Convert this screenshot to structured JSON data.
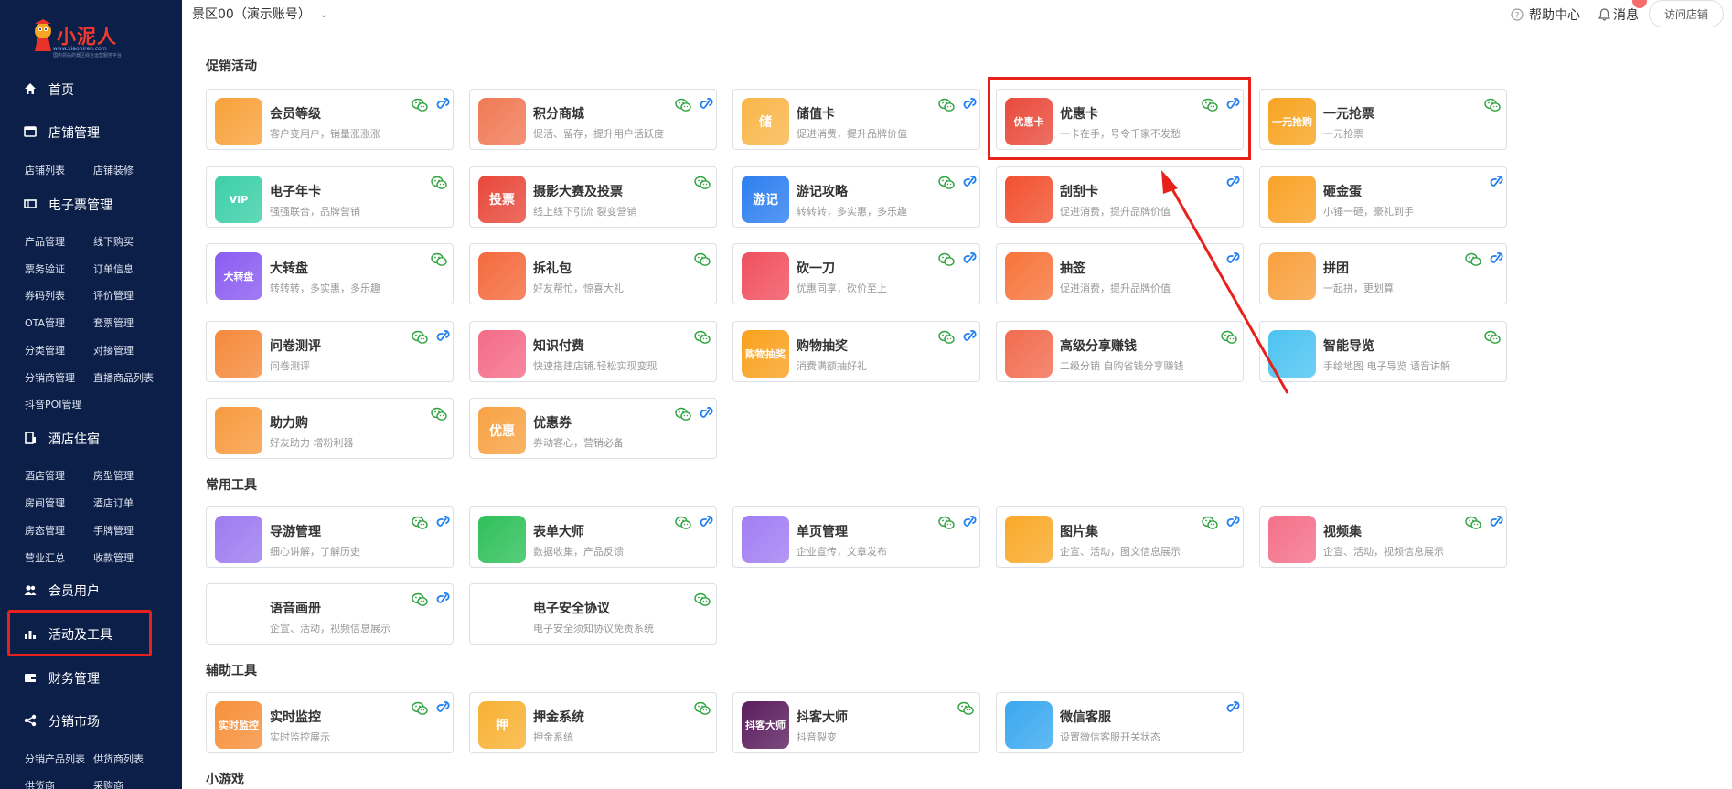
{
  "brand": {
    "name": "小泥人",
    "url_text": "www.xiaoniren.com",
    "tagline": "国内领先的景区综合运营服务平台"
  },
  "topbar": {
    "site": "景区00（演示账号）",
    "help": "帮助中心",
    "messages": "消息",
    "visit": "访问店铺"
  },
  "sidebar": {
    "nav_home": "首页",
    "nav_store": "店铺管理",
    "sub_store_list": "店铺列表",
    "sub_store_decor": "店铺装修",
    "nav_eticket": "电子票管理",
    "sub_product": "产品管理",
    "sub_offline_buy": "线下购买",
    "sub_ticket_verify": "票务验证",
    "sub_order_info": "订单信息",
    "sub_code_list": "券码列表",
    "sub_review": "评价管理",
    "sub_ota": "OTA管理",
    "sub_package": "套票管理",
    "sub_category": "分类管理",
    "sub_docking": "对接管理",
    "sub_distributor": "分销商管理",
    "sub_live_list": "直播商品列表",
    "sub_douyin_poi": "抖音POI管理",
    "nav_hotel": "酒店住宿",
    "sub_hotel_mgmt": "酒店管理",
    "sub_room_type": "房型管理",
    "sub_room_mgmt": "房间管理",
    "sub_hotel_order": "酒店订单",
    "sub_room_status": "房态管理",
    "sub_fee": "手牌管理",
    "sub_business": "营业汇总",
    "sub_cashier": "收款管理",
    "nav_members": "会员用户",
    "nav_activities": "活动及工具",
    "nav_finance": "财务管理",
    "nav_market": "分销市场",
    "sub_dist_product": "分销产品列表",
    "sub_supplier_list": "供货商列表",
    "sub_supplier": "供货商",
    "sub_purchaser": "采购商"
  },
  "sections": {
    "promo": "促销活动",
    "tools": "常用工具",
    "aux": "辅助工具",
    "games": "小游戏"
  },
  "cards": [
    {
      "title": "会员等级",
      "desc": "客户变用户，销量涨涨涨",
      "icon": "star-medal-icon",
      "color": "#f8a23a"
    },
    {
      "title": "积分商城",
      "desc": "促活、留存，提升用户活跃度",
      "icon": "mall-icon",
      "color": "#f07a55"
    },
    {
      "title": "储值卡",
      "desc": "促进消费，提升品牌价值",
      "icon": "card-icon",
      "color": "#f9b64a",
      "glyph": "储"
    },
    {
      "title": "优惠卡",
      "desc": "一卡在手，号令千家不发愁",
      "icon": "coupon-card-icon",
      "color": "#e94b3c",
      "glyph": "优惠卡"
    },
    {
      "title": "一元抢票",
      "desc": "一元抢票",
      "icon": "one-yuan-icon",
      "color": "#f7a421",
      "glyph": "一元抢购"
    },
    {
      "title": "电子年卡",
      "desc": "强强联合，品牌营销",
      "icon": "annual-card-icon",
      "color": "#3ccfa8",
      "glyph": "VIP"
    },
    {
      "title": "摄影大赛及投票",
      "desc": "线上线下引流 裂变营销",
      "icon": "vote-icon",
      "color": "#e8483a",
      "glyph": "投票"
    },
    {
      "title": "游记攻略",
      "desc": "转转转，多实惠，多乐趣",
      "icon": "travel-notes-icon",
      "color": "#2d7ff0",
      "glyph": "游记"
    },
    {
      "title": "刮刮卡",
      "desc": "促进消费，提升品牌价值",
      "icon": "scratch-card-icon",
      "color": "#f2512f"
    },
    {
      "title": "砸金蛋",
      "desc": "小锤一砸，豪礼到手",
      "icon": "golden-egg-icon",
      "color": "#f9a227"
    },
    {
      "title": "大转盘",
      "desc": "转转转，多实惠，多乐趣",
      "icon": "wheel-icon",
      "color": "#8b5cf1",
      "glyph": "大转盘"
    },
    {
      "title": "拆礼包",
      "desc": "好友帮忙，惊喜大礼",
      "icon": "gift-icon",
      "color": "#f46a3c"
    },
    {
      "title": "砍一刀",
      "desc": "优惠同享，砍价至上",
      "icon": "bargain-icon",
      "color": "#f0505e"
    },
    {
      "title": "抽签",
      "desc": "促进消费，提升品牌价值",
      "icon": "lottery-icon",
      "color": "#f7743a"
    },
    {
      "title": "拼团",
      "desc": "一起拼，更划算",
      "icon": "group-buy-icon",
      "color": "#f8a03d"
    },
    {
      "title": "问卷测评",
      "desc": "问卷测评",
      "icon": "survey-icon",
      "color": "#f58a3b"
    },
    {
      "title": "知识付费",
      "desc": "快速搭建店铺,轻松实现变现",
      "icon": "knowledge-icon",
      "color": "#f46b88"
    },
    {
      "title": "购物抽奖",
      "desc": "消费满额抽好礼",
      "icon": "shopping-lottery-icon",
      "color": "#f9a11e",
      "glyph": "购物抽奖"
    },
    {
      "title": "高级分享赚钱",
      "desc": "二级分销 自购省钱分享赚钱",
      "icon": "share-earn-icon",
      "color": "#f26c4f"
    },
    {
      "title": "智能导览",
      "desc": "手绘地图 电子导览 语音讲解",
      "icon": "guide-icon",
      "color": "#4cc3f1"
    },
    {
      "title": "助力购",
      "desc": "好友助力 增粉利器",
      "icon": "assist-buy-icon",
      "color": "#f79a3e"
    },
    {
      "title": "优惠券",
      "desc": "券动客心，营销必备",
      "icon": "coupon-icon",
      "color": "#f8a243",
      "glyph": "优惠"
    },
    {
      "title": "导游管理",
      "desc": "细心讲解，了解历史",
      "icon": "tour-guide-icon",
      "color": "#9d7bf0"
    },
    {
      "title": "表单大师",
      "desc": "数据收集，产品反馈",
      "icon": "form-icon",
      "color": "#2fc05a"
    },
    {
      "title": "单页管理",
      "desc": "企业宣传，文章发布",
      "icon": "single-page-icon",
      "color": "#a17ef3"
    },
    {
      "title": "图片集",
      "desc": "企宣、活动，图文信息展示",
      "icon": "gallery-icon",
      "color": "#f9a928"
    },
    {
      "title": "视频集",
      "desc": "企宣、活动，视频信息展示",
      "icon": "video-icon",
      "color": "#f4708a"
    },
    {
      "title": "语音画册",
      "desc": "企宣、活动，视频信息展示",
      "icon": "none",
      "color": "#ffffff"
    },
    {
      "title": "电子安全协议",
      "desc": "电子安全须知协议免责系统",
      "icon": "none",
      "color": "#ffffff"
    },
    {
      "title": "实时监控",
      "desc": "实时监控展示",
      "icon": "camera-icon",
      "color": "#f7903b",
      "glyph": "实时监控"
    },
    {
      "title": "押金系统",
      "desc": "押金系统",
      "icon": "deposit-icon",
      "color": "#f8b133",
      "glyph": "押"
    },
    {
      "title": "抖客大师",
      "desc": "抖音裂变",
      "icon": "douke-icon",
      "color": "#5b1d5e",
      "glyph": "抖客大师"
    },
    {
      "title": "微信客服",
      "desc": "设置微信客服开关状态",
      "icon": "wechat-service-icon",
      "color": "#3aa8ef"
    }
  ],
  "colors": {
    "sidebar_bg": "#0c1f48",
    "highlight": "#e8211b",
    "wechat": "#2fa33f",
    "link": "#1e7ff0"
  }
}
